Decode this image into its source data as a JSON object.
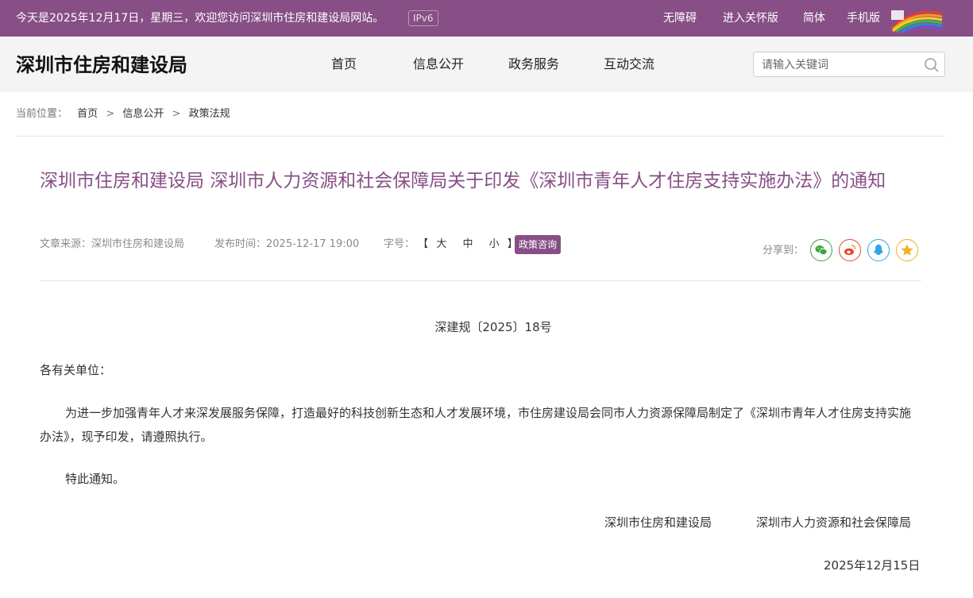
{
  "topbar": {
    "welcome": "今天是2025年12月17日，星期三，欢迎您访问深圳市住房和建设局网站。",
    "ipv6": "IPv6",
    "links": [
      "无障碍",
      "进入关怀版",
      "简体",
      "手机版"
    ]
  },
  "header": {
    "site_title": "深圳市住房和建设局",
    "nav": [
      "首页",
      "信息公开",
      "政务服务",
      "互动交流"
    ],
    "search_placeholder": "请输入关键词"
  },
  "breadcrumb": {
    "label": "当前位置：",
    "items": [
      "首页",
      "信息公开",
      "政策法规"
    ],
    "separator": ">"
  },
  "article": {
    "title": "深圳市住房和建设局 深圳市人力资源和社会保障局关于印发《深圳市青年人才住房支持实施办法》的通知",
    "source": "文章来源：深圳市住房和建设局",
    "published": "发布时间：2025-12-17 19:00",
    "font_size_label": "字号：",
    "font_sizes": [
      "大",
      "中",
      "小"
    ],
    "bracket_open": "【",
    "bracket_close": "】",
    "tag": "政策咨询",
    "share_label": "分享到：",
    "share_icons": [
      "wechat-icon",
      "weibo-icon",
      "qq-icon",
      "qzone-icon"
    ],
    "doc_number": "深建规〔2025〕18号",
    "addressee": "各有关单位：",
    "body": "为进一步加强青年人才来深发展服务保障，打造最好的科技创新生态和人才发展环境，市住房建设局会同市人力资源保障局制定了《深圳市青年人才住房支持实施办法》，现予印发，请遵照执行。",
    "closing": "特此通知。",
    "signatories": [
      "深圳市住房和建设局",
      "深圳市人力资源和社会保障局"
    ],
    "date": "2025年12月15日"
  },
  "colors": {
    "brand": "#874f86",
    "wechat": "#3aa53a",
    "weibo": "#e6462c",
    "qq": "#2aa7e6",
    "qzone": "#f2b01e"
  }
}
